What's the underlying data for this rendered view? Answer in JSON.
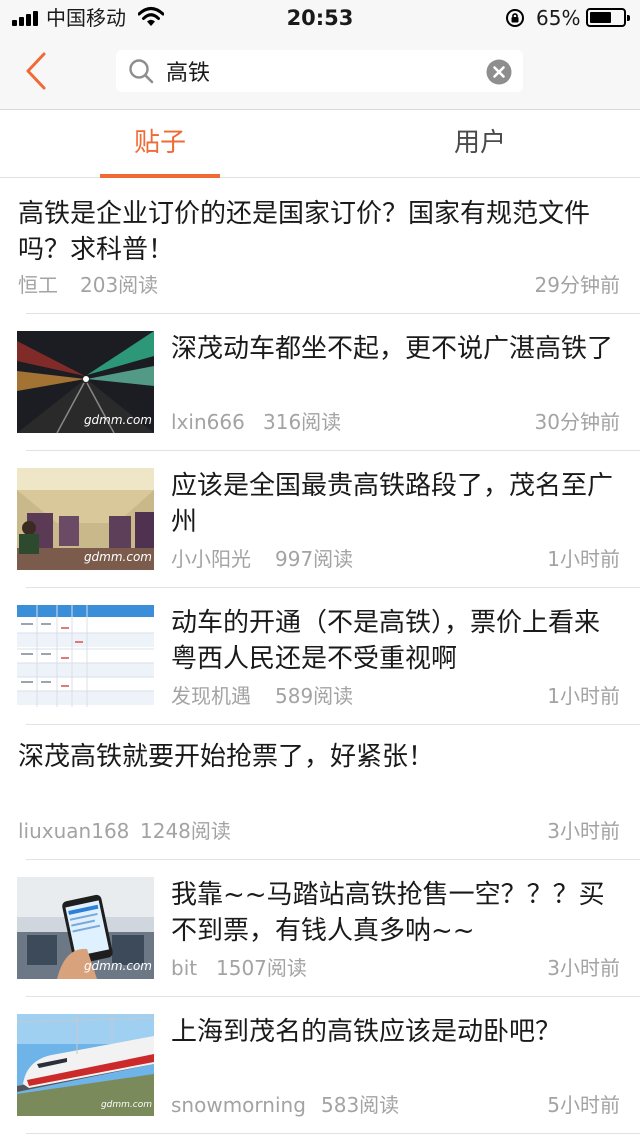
{
  "status_bar": {
    "carrier": "中国移动",
    "time": "20:53",
    "battery_percent": "65%",
    "battery_level": 0.65,
    "icons": [
      "signal-icon",
      "wifi-icon",
      "orientation-lock-icon",
      "battery-icon"
    ]
  },
  "nav": {
    "back_icon": "chevron-left-icon",
    "search_value": "高铁",
    "search_icon": "search-icon",
    "clear_icon": "clear-icon"
  },
  "tabs": [
    {
      "label": "贴子",
      "active": true
    },
    {
      "label": "用户",
      "active": false
    }
  ],
  "colors": {
    "accent": "#f06a35",
    "text": "#1a1a1a",
    "meta": "#a3a3a3",
    "divider": "#e2e2e2"
  },
  "posts": [
    {
      "title": "高铁是企业订价的还是国家订价？国家有规范文件吗？求科普！",
      "author": "恒工",
      "reads": "203阅读",
      "time": "29分钟前",
      "thumbnail": null
    },
    {
      "title": "深茂动车都坐不起，更不说广湛高铁了",
      "author": "lxin666",
      "reads": "316阅读",
      "time": "30分钟前",
      "thumbnail": "tunnel-light-photo",
      "watermark": "gdmm.com"
    },
    {
      "title": "应该是全国最贵高铁路段了，茂名至广州",
      "author": "小小阳光",
      "reads": "997阅读",
      "time": "1小时前",
      "thumbnail": "train-interior-photo",
      "watermark": "gdmm.com"
    },
    {
      "title": "动车的开通（不是高铁），票价上看来粤西人民还是不受重视啊",
      "author": "发现机遇",
      "reads": "589阅读",
      "time": "1小时前",
      "thumbnail": "timetable-screenshot",
      "watermark": ""
    },
    {
      "title": "深茂高铁就要开始抢票了，好紧张！",
      "author": "liuxuan168",
      "reads": "1248阅读",
      "time": "3小时前",
      "thumbnail": null
    },
    {
      "title": "我靠~~马踏站高铁抢售一空？？？买不到票，有钱人真多呐~~",
      "author": "bit",
      "reads": "1507阅读",
      "time": "3小时前",
      "thumbnail": "phone-ticket-photo",
      "watermark": "gdmm.com"
    },
    {
      "title": "上海到茂名的高铁应该是动卧吧？",
      "author": "snowmorning",
      "reads": "583阅读",
      "time": "5小时前",
      "thumbnail": "red-train-photo",
      "watermark": "gdmm.com"
    }
  ]
}
